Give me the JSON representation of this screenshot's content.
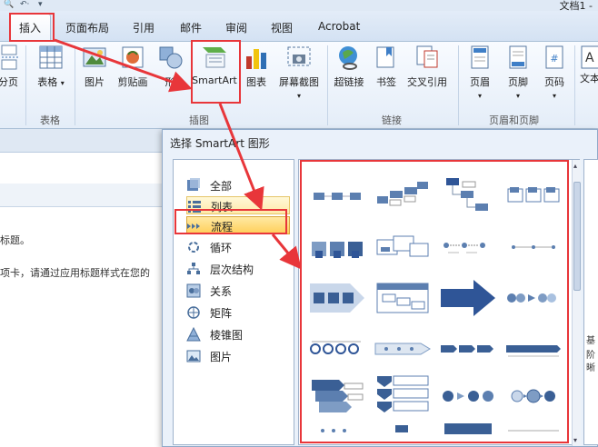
{
  "window": {
    "doc_title": "文档1 -"
  },
  "qat": {
    "icon1": "search-icon",
    "icon2": "undo-icon",
    "icon3": "dropdown-icon"
  },
  "tabs": [
    {
      "label": "插入",
      "active": true
    },
    {
      "label": "页面布局"
    },
    {
      "label": "引用"
    },
    {
      "label": "邮件"
    },
    {
      "label": "审阅"
    },
    {
      "label": "视图"
    },
    {
      "label": "Acrobat"
    }
  ],
  "ribbon": {
    "buttons": {
      "page_break": "分页",
      "table": "表格",
      "picture": "图片",
      "clipart": "剪贴画",
      "shapes": "形",
      "smartart": "SmartArt",
      "chart": "图表",
      "screenshot": "屏幕截图",
      "hyperlink": "超链接",
      "bookmark": "书签",
      "crossref": "交叉引用",
      "header": "页眉",
      "footer": "页脚",
      "pagenum": "页码",
      "textbox": "文本"
    },
    "groups": {
      "table": "表格",
      "illustrations": "插图",
      "links": "链接",
      "header_footer": "页眉和页脚"
    }
  },
  "document": {
    "line1": "标题。",
    "line2": "项卡，请通过应用标题样式在您的"
  },
  "dialog": {
    "title": "选择 SmartArt 图形",
    "categories": [
      {
        "label": "全部",
        "icon": "all-icon"
      },
      {
        "label": "列表",
        "icon": "list-icon",
        "state": "hover"
      },
      {
        "label": "流程",
        "icon": "process-icon",
        "state": "selected"
      },
      {
        "label": "循环",
        "icon": "cycle-icon"
      },
      {
        "label": "层次结构",
        "icon": "hierarchy-icon"
      },
      {
        "label": "关系",
        "icon": "relationship-icon"
      },
      {
        "label": "矩阵",
        "icon": "matrix-icon"
      },
      {
        "label": "棱锥图",
        "icon": "pyramid-icon"
      },
      {
        "label": "图片",
        "icon": "picture-icon"
      }
    ],
    "right_panel_text": [
      "基",
      "阶",
      "晰"
    ]
  },
  "colors": {
    "accent": "#2f5597",
    "annotation": "#e8363a",
    "ribbon_bg": "#e4edf8"
  }
}
